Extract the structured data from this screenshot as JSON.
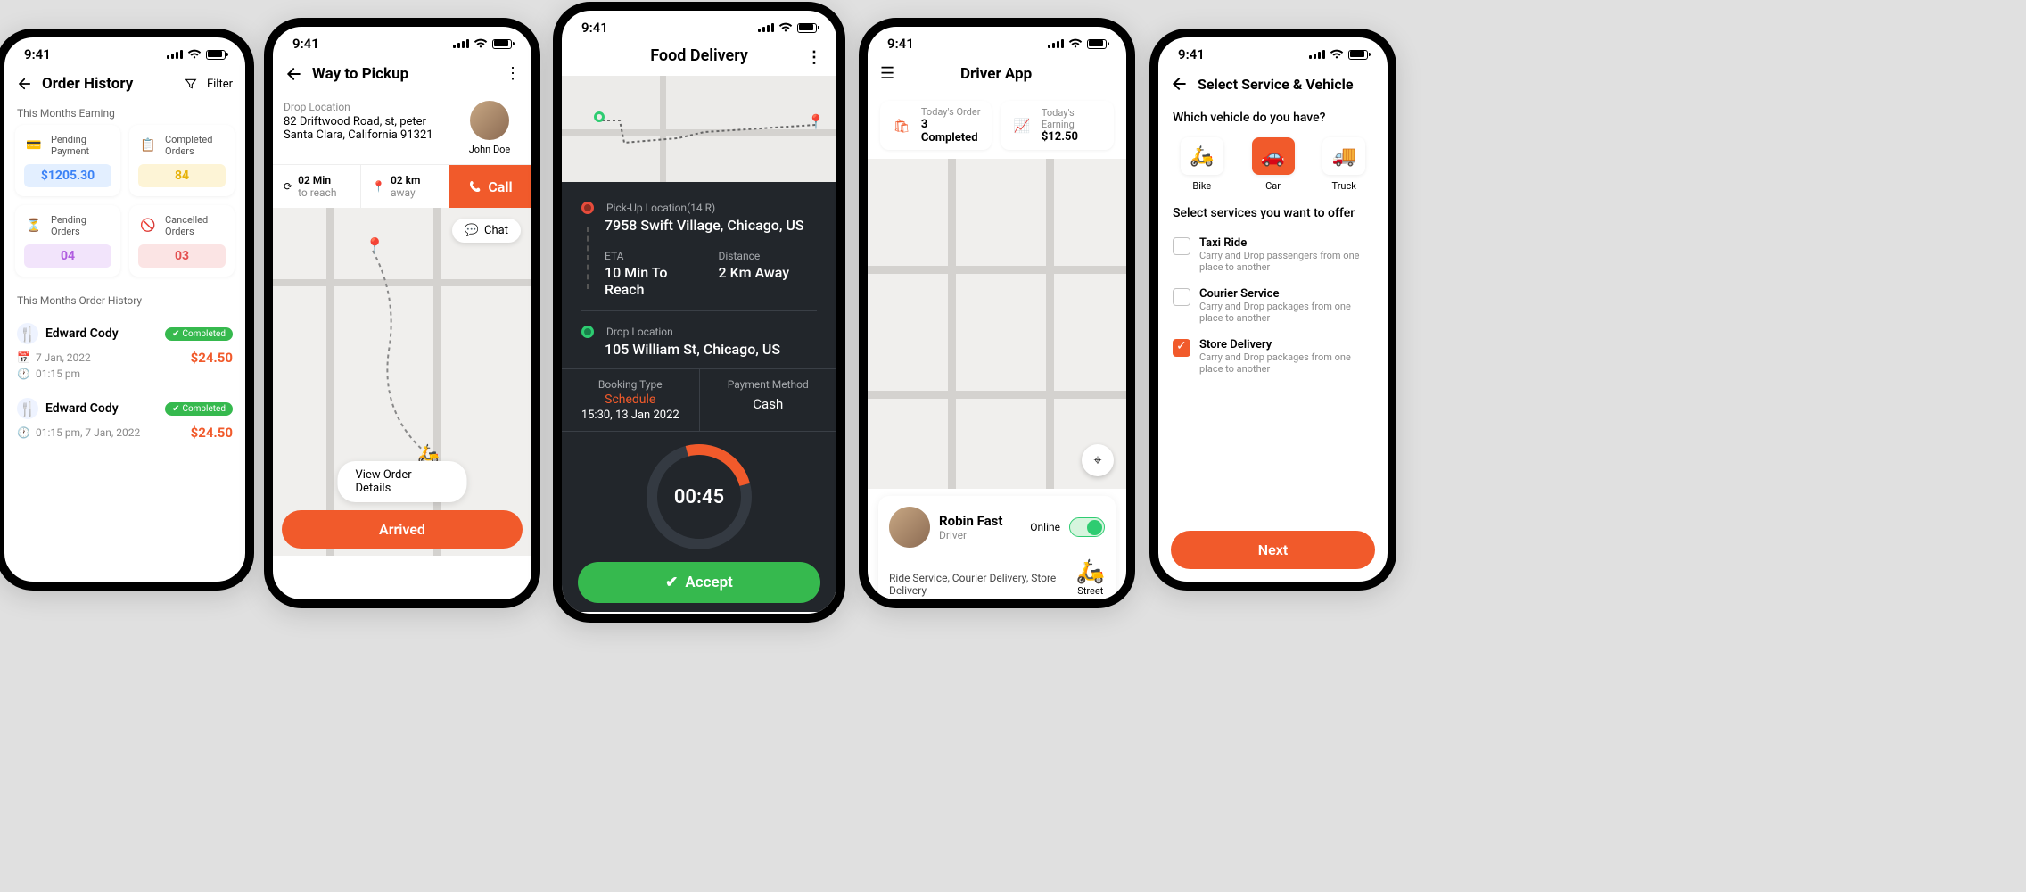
{
  "status_time": "9:41",
  "p1": {
    "title": "Order History",
    "filter": "Filter",
    "earning_label": "This Months Earning",
    "cards": [
      {
        "label1": "Pending",
        "label2": "Payment",
        "value": "$1205.30",
        "color": "#3b82f6",
        "bg": "#e3efff"
      },
      {
        "label1": "Completed",
        "label2": "Orders",
        "value": "84",
        "color": "#e6b20a",
        "bg": "#fdf4d6"
      },
      {
        "label1": "Pending",
        "label2": "Orders",
        "value": "04",
        "color": "#b05ce0",
        "bg": "#f2e4fb"
      },
      {
        "label1": "Cancelled",
        "label2": "Orders",
        "value": "03",
        "color": "#e35050",
        "bg": "#fbe4e4"
      }
    ],
    "history_label": "This Months Order History",
    "orders": [
      {
        "name": "Edward Cody",
        "status": "Completed",
        "date": "7 Jan, 2022",
        "time": "01:15 pm",
        "amount": "$24.50"
      },
      {
        "name": "Edward Cody",
        "status": "Completed",
        "datetime": "01:15 pm, 7 Jan, 2022",
        "amount": "$24.50"
      }
    ]
  },
  "p2": {
    "title": "Way to Pickup",
    "drop_label": "Drop Location",
    "address_l1": "82  Driftwood Road, st, peter",
    "address_l2": "Santa Clara, California 91321",
    "customer": "John Doe",
    "eta_val": "02 Min",
    "eta_label": "to reach",
    "dist_val": "02 km",
    "dist_label": "away",
    "call": "Call",
    "chat": "Chat",
    "view_details": "View Order Details",
    "arrived": "Arrived"
  },
  "p3": {
    "title": "Food Delivery",
    "pickup_label": "Pick-Up Location(14 R)",
    "pickup": "7958 Swift Village, Chicago, US",
    "eta_label": "ETA",
    "eta": "10 Min To Reach",
    "dist_label": "Distance",
    "dist": "2 Km Away",
    "drop_label": "Drop Location",
    "drop": "105 William St, Chicago, US",
    "bt_label": "Booking Type",
    "bt_val": "Schedule",
    "bt_time": "15:30, 13 Jan 2022",
    "pm_label": "Payment Method",
    "pm_val": "Cash",
    "timer": "00:45",
    "accept": "Accept"
  },
  "p4": {
    "title": "Driver App",
    "order_label": "Today's Order",
    "order_val": "3 Completed",
    "earn_label": "Today's Earning",
    "earn_val": "$12.50",
    "driver_name": "Robin Fast",
    "driver_role": "Driver",
    "online": "Online",
    "services": "Ride Service, Courier Delivery, Store Delivery",
    "vehicle": "Street"
  },
  "p5": {
    "title": "Select Service & Vehicle",
    "q_vehicle": "Which vehicle do you have?",
    "vehicles": [
      {
        "label": "Bike",
        "selected": false
      },
      {
        "label": "Car",
        "selected": true
      },
      {
        "label": "Truck",
        "selected": false
      }
    ],
    "q_services": "Select services you want to offer",
    "services": [
      {
        "title": "Taxi Ride",
        "desc": "Carry and Drop passengers from one place to another",
        "checked": false
      },
      {
        "title": "Courier Service",
        "desc": "Carry and Drop packages from one place to another",
        "checked": false
      },
      {
        "title": "Store Delivery",
        "desc": "Carry and Drop packages from one place to another",
        "checked": true
      }
    ],
    "next": "Next"
  }
}
